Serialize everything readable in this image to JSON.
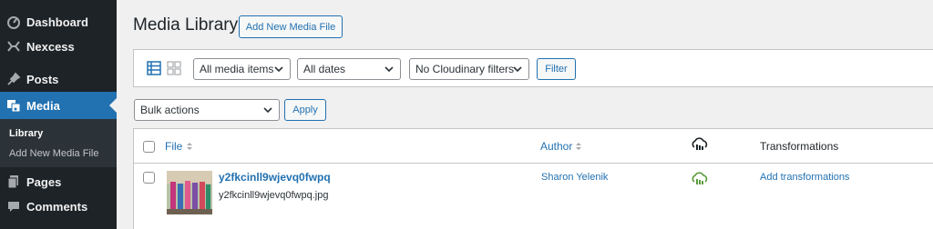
{
  "sidebar": {
    "items": [
      {
        "label": "Dashboard",
        "icon": "dashboard-icon"
      },
      {
        "label": "Nexcess",
        "icon": "nexcess-icon"
      },
      {
        "label": "Posts",
        "icon": "pin-icon"
      },
      {
        "label": "Media",
        "icon": "media-icon",
        "active": true
      },
      {
        "label": "Pages",
        "icon": "pages-icon"
      },
      {
        "label": "Comments",
        "icon": "comments-icon"
      }
    ],
    "submenu": [
      {
        "label": "Library",
        "current": true
      },
      {
        "label": "Add New Media File"
      }
    ]
  },
  "header": {
    "title": "Media Library",
    "add_new_label": "Add New Media File"
  },
  "filters": {
    "media_items": "All media items",
    "dates": "All dates",
    "cloudinary": "No Cloudinary filters",
    "filter_label": "Filter"
  },
  "bulk": {
    "selected": "Bulk actions",
    "apply_label": "Apply"
  },
  "table": {
    "columns": {
      "file": "File",
      "author": "Author",
      "transformations": "Transformations"
    },
    "rows": [
      {
        "title": "y2fkcinll9wjevq0fwpq",
        "filename": "y2fkcinll9wjevq0fwpq.jpg",
        "author": "Sharon Yelenik",
        "transform_link": "Add transformations",
        "cloud_status_color": "#5b9b3b"
      }
    ]
  },
  "colors": {
    "accent": "#2271b1",
    "sidebar": "#1d2327",
    "cloud_synced": "#5b9b3b"
  }
}
